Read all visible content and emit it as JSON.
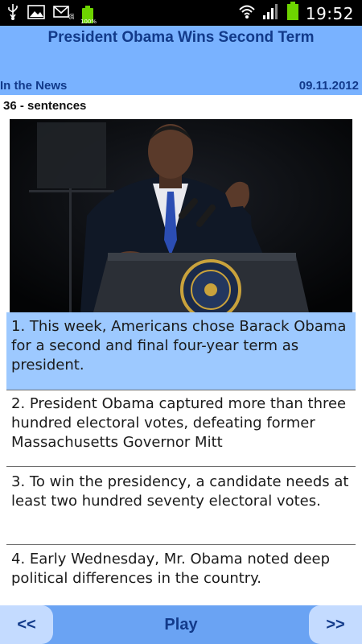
{
  "status_bar": {
    "time": "19:52",
    "battery_small_label": "100%",
    "icons": [
      "usb-icon",
      "image-icon",
      "mail-icon",
      "battery-icon",
      "wifi-icon",
      "signal-icon",
      "battery-icon"
    ]
  },
  "header": {
    "title": "President Obama Wins Second Term",
    "section": "In the News",
    "date": "09.11.2012"
  },
  "sentence_count": "36 -  sentences",
  "sentences": [
    "1. This week, Americans chose Barack Obama for a second and final four-year term as president.",
    "2. President Obama captured more than three hundred electoral votes, defeating former Massachusetts Governor Mitt",
    "3. To win the presidency, a candidate needs at least two hundred seventy electoral votes.",
    "4. Early Wednesday, Mr. Obama noted deep political differences in the country."
  ],
  "controls": {
    "prev_label": "<<",
    "play_label": "Play",
    "next_label": ">>"
  },
  "colors": {
    "header_bg": "#79b2ff",
    "title_text": "#123a8a",
    "active_sentence_bg": "#9dc9ff",
    "bottom_bar_bg": "#6aa3f3",
    "nav_button_bg": "#c4dbff"
  }
}
